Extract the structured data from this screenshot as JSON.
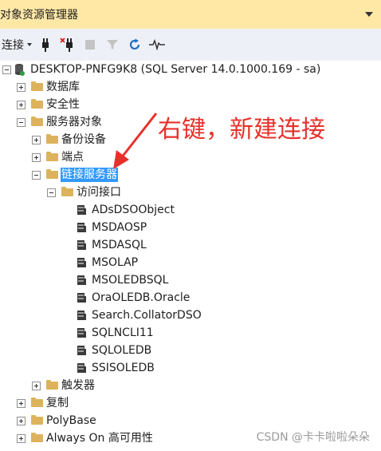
{
  "window": {
    "title": "对象资源管理器"
  },
  "toolbar": {
    "connect_label": "连接"
  },
  "tree": {
    "server": "DESKTOP-PNFG9K8 (SQL Server 14.0.1000.169 - sa)",
    "databases": "数据库",
    "security": "安全性",
    "server_objects": "服务器对象",
    "backup_devices": "备份设备",
    "endpoints": "端点",
    "linked_servers": "链接服务器",
    "providers": "访问接口",
    "provider_items": [
      "ADsDSOObject",
      "MSDAOSP",
      "MSDASQL",
      "MSOLAP",
      "MSOLEDBSQL",
      "OraOLEDB.Oracle",
      "Search.CollatorDSO",
      "SQLNCLI11",
      "SQLOLEDB",
      "SSISOLEDB"
    ],
    "triggers": "触发器",
    "replication": "复制",
    "polybase": "PolyBase",
    "always_on": "Always On 高可用性"
  },
  "annotation": {
    "text": "右键，新建连接",
    "color": "#e8302a"
  },
  "watermark": "CSDN @卡卡啦啦朵朵"
}
